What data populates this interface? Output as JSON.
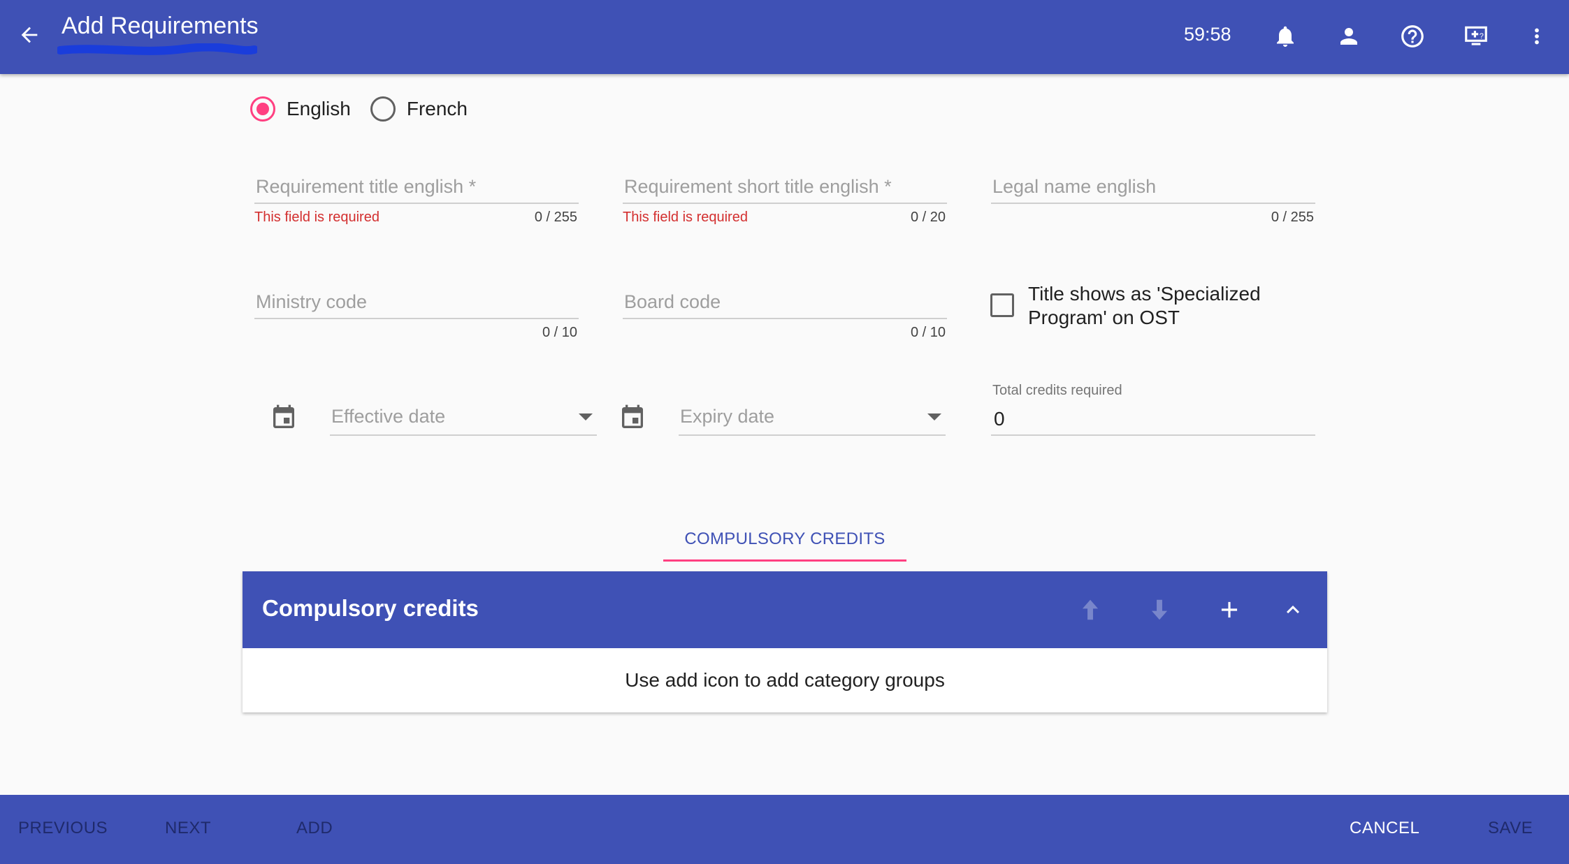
{
  "app_bar": {
    "title": "Add Requirements",
    "timer": "59:58",
    "back_icon": "arrow-back-icon",
    "icons": [
      "bell-icon",
      "person-icon",
      "help-icon",
      "remote-desktop-icon",
      "more-vert-icon"
    ]
  },
  "language": {
    "options": [
      "English",
      "French"
    ],
    "selected": "English"
  },
  "fields": {
    "req_title": {
      "placeholder": "Requirement title english *",
      "error": "This field is required",
      "counter": "0 / 255"
    },
    "short_title": {
      "placeholder": "Requirement short title english *",
      "error": "This field is required",
      "counter": "0 / 20"
    },
    "legal_name": {
      "placeholder": "Legal name english",
      "counter": "0 / 255"
    },
    "ministry_code": {
      "placeholder": "Ministry code",
      "counter": "0 / 10"
    },
    "board_code": {
      "placeholder": "Board code",
      "counter": "0 / 10"
    },
    "specialized_checkbox": {
      "label": "Title shows as 'Specialized Program' on OST",
      "checked": false
    },
    "effective_date": {
      "placeholder": "Effective date"
    },
    "expiry_date": {
      "placeholder": "Expiry date"
    },
    "total_credits": {
      "label": "Total credits required",
      "value": "0"
    }
  },
  "tabs": [
    {
      "label": "COMPULSORY CREDITS",
      "active": true
    }
  ],
  "panel": {
    "title": "Compulsory credits",
    "empty_message": "Use add icon to add category groups",
    "icons": [
      "arrow-up-icon",
      "arrow-down-icon",
      "add-icon",
      "collapse-icon"
    ]
  },
  "bottom_bar": {
    "previous": "PREVIOUS",
    "next": "NEXT",
    "add": "ADD",
    "cancel": "CANCEL",
    "save": "SAVE"
  },
  "colors": {
    "primary": "#3f51b5",
    "accent": "#ff4081",
    "error": "#d32f2f"
  }
}
